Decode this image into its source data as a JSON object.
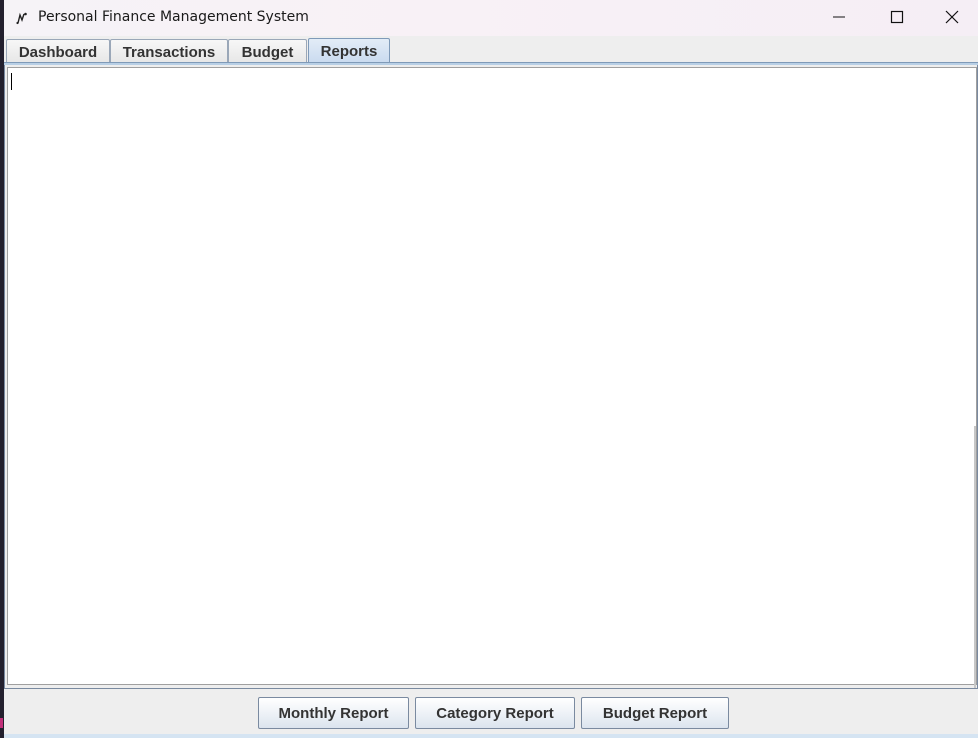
{
  "window": {
    "title": "Personal Finance Management System",
    "icon": "app-icon",
    "controls": [
      "minimize-icon",
      "maximize-icon",
      "close-icon"
    ]
  },
  "tabs": [
    {
      "label": "Dashboard",
      "active": false
    },
    {
      "label": "Transactions",
      "active": false
    },
    {
      "label": "Budget",
      "active": false
    },
    {
      "label": "Reports",
      "active": true
    }
  ],
  "reports": {
    "output_text": "",
    "buttons": {
      "monthly_label": "Monthly Report",
      "category_label": "Category Report",
      "budget_label": "Budget Report"
    }
  },
  "colors": {
    "active_tab": "#c8daef",
    "tab_border": "#7f9ab8",
    "button_gradient_end": "#dbe4ee"
  }
}
